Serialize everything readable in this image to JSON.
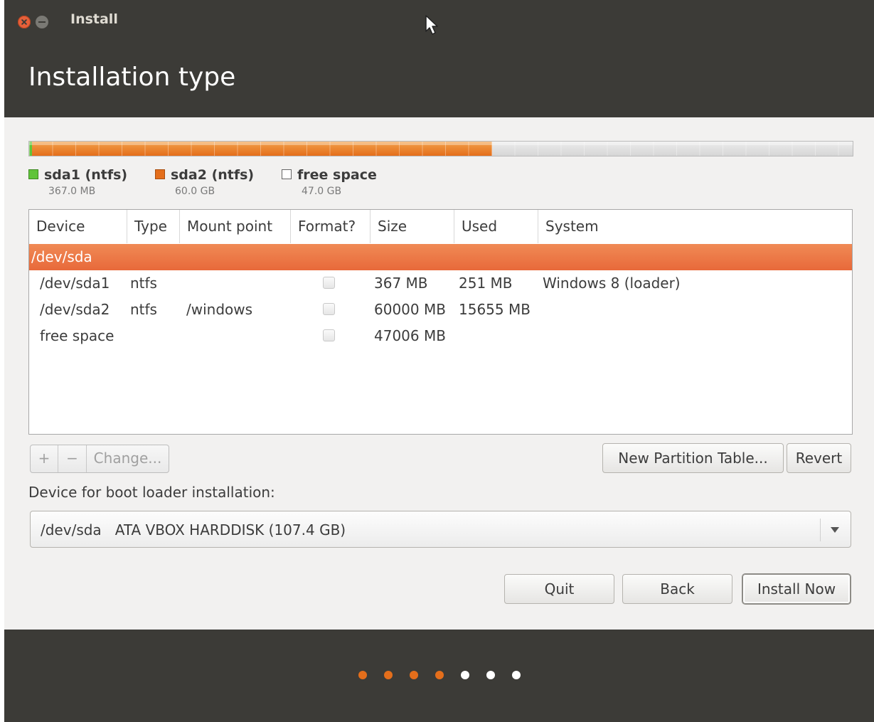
{
  "window": {
    "title": "Install",
    "page_title": "Installation type"
  },
  "disk_usage": {
    "sda1_fraction": 0.0034,
    "sda2_fraction": 0.5588,
    "free_fraction": 0.4378,
    "colors": {
      "sda1": "#60c43a",
      "sda2": "#e46e1b",
      "free": "#e2e2e2"
    }
  },
  "legend": [
    {
      "name": "sda1 (ntfs)",
      "size": "367.0 MB",
      "color": "#60c43a"
    },
    {
      "name": "sda2 (ntfs)",
      "size": "60.0 GB",
      "color": "#e46e1b"
    },
    {
      "name": "free space",
      "size": "47.0 GB",
      "color": "#ffffff"
    }
  ],
  "table": {
    "columns": [
      "Device",
      "Type",
      "Mount point",
      "Format?",
      "Size",
      "Used",
      "System"
    ],
    "selected_row": "/dev/sda",
    "rows": [
      {
        "device": "/dev/sda1",
        "type": "ntfs",
        "mount": "",
        "format": false,
        "size": "367 MB",
        "used": "251 MB",
        "system": "Windows 8 (loader)"
      },
      {
        "device": "/dev/sda2",
        "type": "ntfs",
        "mount": "/windows",
        "format": false,
        "size": "60000 MB",
        "used": "15655 MB",
        "system": ""
      },
      {
        "device": "free space",
        "type": "",
        "mount": "",
        "format": false,
        "size": "47006 MB",
        "used": "",
        "system": ""
      }
    ]
  },
  "partition_buttons": {
    "add": "+",
    "remove": "−",
    "change": "Change..."
  },
  "actions": {
    "new_partition_table": "New Partition Table...",
    "revert": "Revert"
  },
  "boot_loader": {
    "label": "Device for boot loader installation:",
    "device": "/dev/sda",
    "description": "ATA VBOX HARDDISK (107.4 GB)"
  },
  "nav": {
    "quit": "Quit",
    "back": "Back",
    "install_now": "Install Now"
  },
  "progress": {
    "total_steps": 7,
    "completed_steps": 4,
    "active_color": "#e46e1b",
    "inactive_color": "#ffffff"
  }
}
